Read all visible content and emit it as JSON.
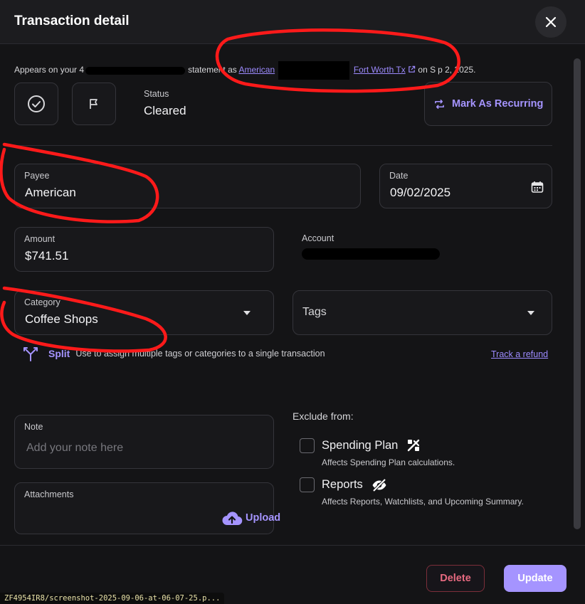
{
  "header": {
    "title": "Transaction detail"
  },
  "appears_on": {
    "prefix": "Appears on your 4",
    "mid": "statement as",
    "link1": "American",
    "link2": "Fort Worth Tx",
    "suffix_a": "on S",
    "suffix_b": "p 2, 2025."
  },
  "status": {
    "label": "Status",
    "value": "Cleared"
  },
  "recurring": {
    "label": "Mark As Recurring"
  },
  "payee": {
    "label": "Payee",
    "value": "American"
  },
  "date": {
    "label": "Date",
    "value": "09/02/2025"
  },
  "amount": {
    "label": "Amount",
    "value": "$741.51"
  },
  "account": {
    "label": "Account"
  },
  "category": {
    "label": "Category",
    "value": "Coffee Shops"
  },
  "tags": {
    "label": "Tags"
  },
  "split": {
    "label": "Split",
    "description": "Use to assign multiple tags or categories to a single transaction",
    "refund_link": "Track a refund"
  },
  "note": {
    "label": "Note",
    "placeholder": "Add your note here"
  },
  "attachments": {
    "label": "Attachments",
    "upload": "Upload"
  },
  "exclude": {
    "heading": "Exclude from:",
    "options": [
      {
        "title": "Spending Plan",
        "subtitle": "Affects Spending Plan calculations.",
        "checked": false
      },
      {
        "title": "Reports",
        "subtitle": "Affects Reports, Watchlists, and Upcoming Summary.",
        "checked": false
      }
    ]
  },
  "footer": {
    "delete": "Delete",
    "update": "Update"
  },
  "file_path": "ZF4954IR8/screenshot-2025-09-06-at-06-07-25.p...",
  "colors": {
    "accent": "#a594ff",
    "danger": "#e76a80",
    "annotation": "#ff1a1a",
    "background": "#141416"
  }
}
